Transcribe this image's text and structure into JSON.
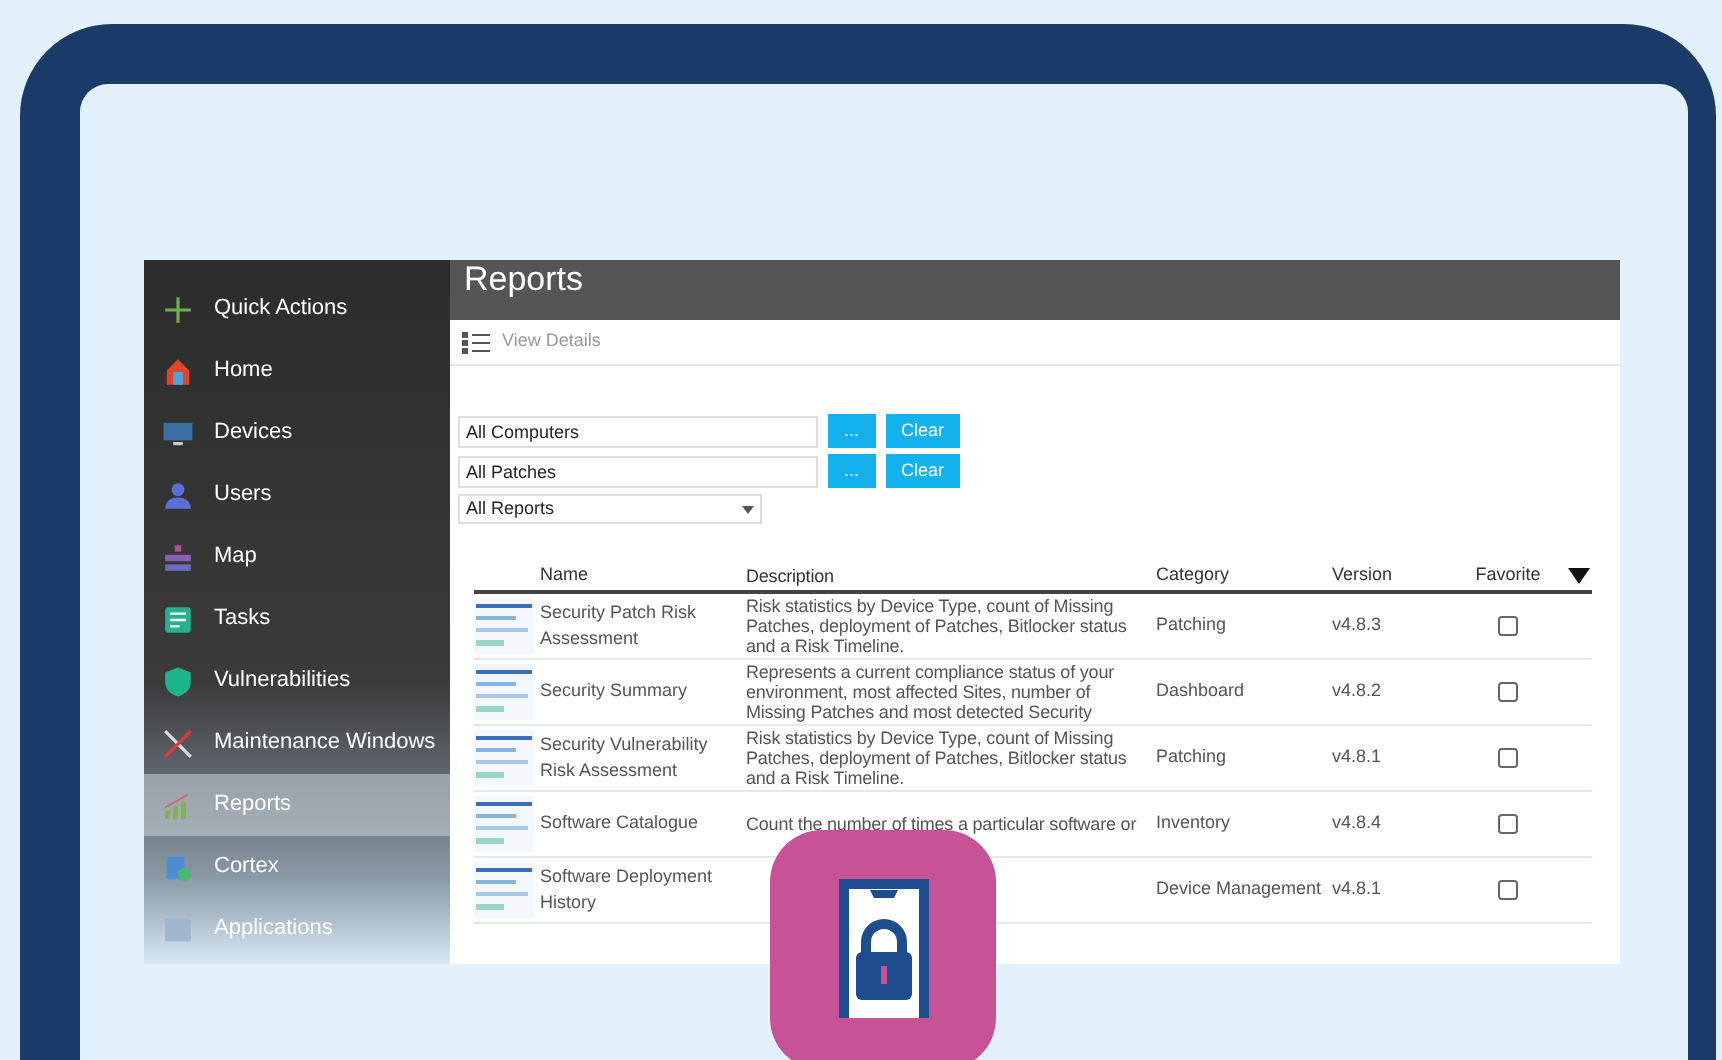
{
  "sidebar": {
    "items": [
      {
        "label": "Quick Actions",
        "selected": false
      },
      {
        "label": "Home",
        "selected": false
      },
      {
        "label": "Devices",
        "selected": false
      },
      {
        "label": "Users",
        "selected": false
      },
      {
        "label": "Map",
        "selected": false
      },
      {
        "label": "Tasks",
        "selected": false
      },
      {
        "label": "Vulnerabilities",
        "selected": false
      },
      {
        "label": "Maintenance Windows",
        "selected": false
      },
      {
        "label": "Reports",
        "selected": true
      },
      {
        "label": "Cortex",
        "selected": false
      },
      {
        "label": "Applications",
        "selected": false
      }
    ]
  },
  "page": {
    "title": "Reports",
    "toolbar": {
      "view_details": "View Details"
    },
    "filters": [
      {
        "value": "All Computers",
        "browse": "...",
        "clear": "Clear"
      },
      {
        "value": "All Patches",
        "browse": "...",
        "clear": "Clear"
      }
    ],
    "report_select": {
      "value": "All Reports"
    }
  },
  "table": {
    "columns": [
      "Name",
      "Description",
      "Category",
      "Version",
      "Favorite"
    ],
    "rows": [
      {
        "name": "Security Patch Risk Assessment",
        "description": "Risk statistics by Device Type, count of Missing Patches, deployment of Patches, Bitlocker status and a Risk Timeline.",
        "category": "Patching",
        "version": "v4.8.3",
        "favorite": false
      },
      {
        "name": "Security Summary",
        "description": "Represents a current compliance status of your environment, most affected Sites, number of Missing Patches and most detected Security",
        "category": "Dashboard",
        "version": "v4.8.2",
        "favorite": false
      },
      {
        "name": "Security Vulnerability Risk Assessment",
        "description": "Risk statistics by Device Type, count of Missing Patches, deployment of Patches, Bitlocker status and a Risk Timeline.",
        "category": "Patching",
        "version": "v4.8.1",
        "favorite": false
      },
      {
        "name": "Software Catalogue",
        "description": "Count the number of times a particular software or",
        "category": "Inventory",
        "version": "v4.8.4",
        "favorite": false
      },
      {
        "name": "Software Deployment History",
        "description": "",
        "category": "Device Management",
        "version": "v4.8.1",
        "favorite": false
      }
    ]
  }
}
